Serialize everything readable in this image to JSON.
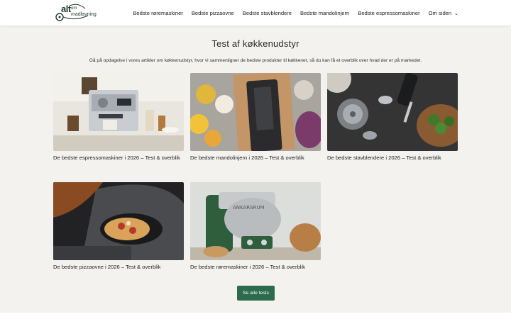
{
  "header": {
    "logo": {
      "line1": "alt",
      "line2": "om",
      "line3": "madlavning"
    },
    "nav": [
      {
        "label": "Bedste røremaskiner"
      },
      {
        "label": "Bedste pizzaovne"
      },
      {
        "label": "Bedste stavblendere"
      },
      {
        "label": "Bedste mandolinjern"
      },
      {
        "label": "Bedste espressomaskiner"
      },
      {
        "label": "Om siden"
      }
    ]
  },
  "main": {
    "title": "Test af køkkenudstyr",
    "intro": "Gå på opdagelse i vores artikler om køkkenudstyr, hvor vi sammenligner de bedste produkter til køkkenet, så du kan få et overblik over hvad der er på markedet.",
    "articles": [
      {
        "caption": "De bedste espressomaskiner i 2026 – Test & overblik",
        "image": "espresso-machine-photo"
      },
      {
        "caption": "De bedste mandolinjern i 2026 – Test & overblik",
        "image": "mandoline-slicer-photo"
      },
      {
        "caption": "De bedste stavblendere i 2026 – Test & overblik",
        "image": "hand-blender-photo"
      },
      {
        "caption": "De bedste pizzaovne i 2026 – Test & overblik",
        "image": "pizza-oven-photo"
      },
      {
        "caption": "De bedste røremaskiner i 2026 – Test & overblik",
        "image": "stand-mixer-photo"
      }
    ],
    "button_label": "Se alle tests",
    "mixer_brand": "ANKARSRUM"
  },
  "colors": {
    "accent": "#2d6b4d",
    "background": "#f4f2ef",
    "header": "#ffffff"
  }
}
